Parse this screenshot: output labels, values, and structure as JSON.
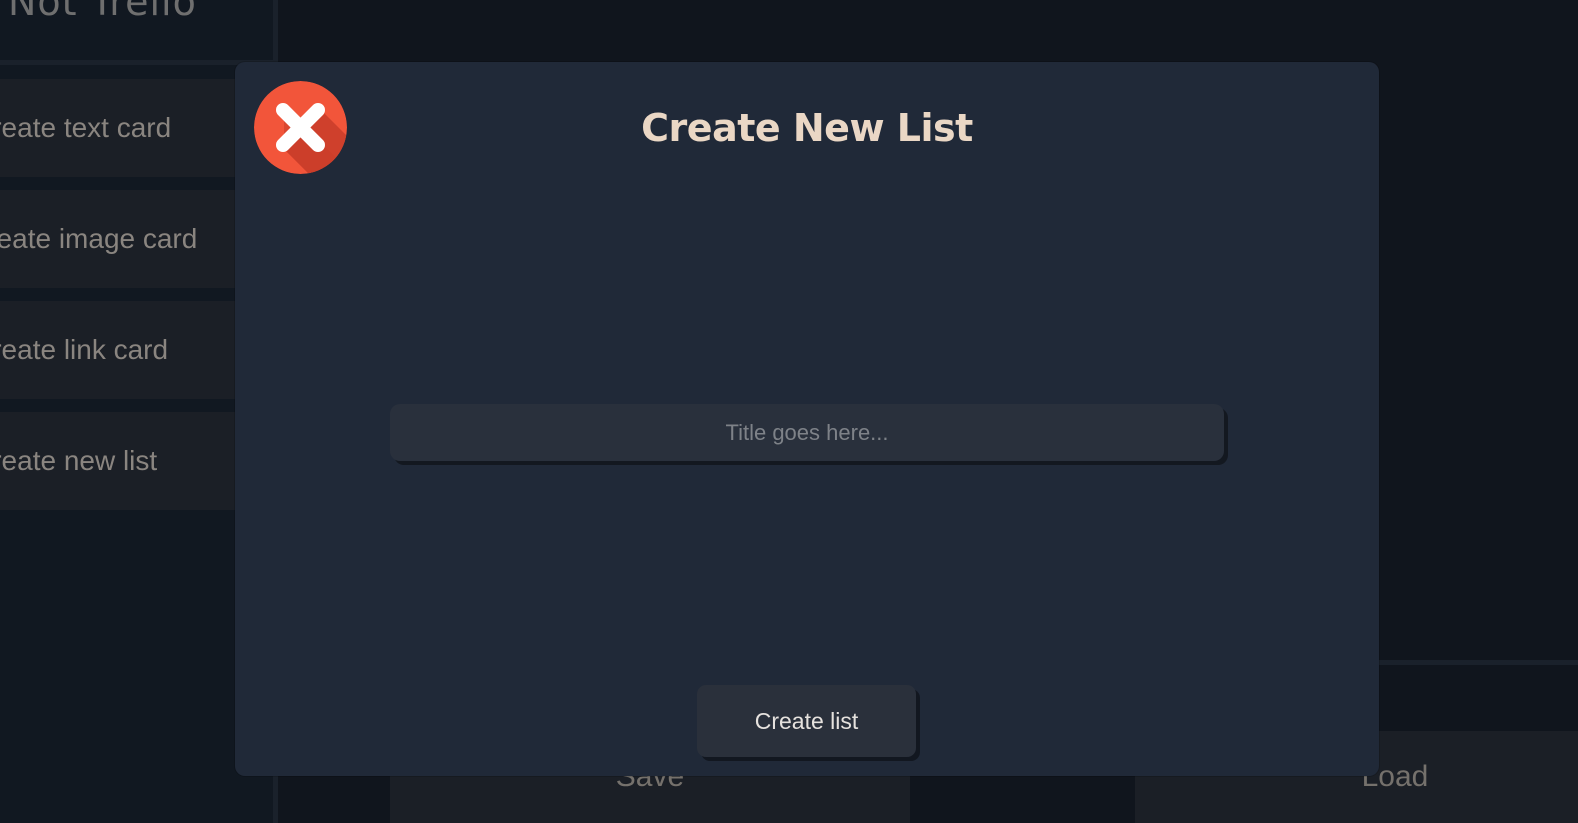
{
  "app": {
    "title": "Not Trello"
  },
  "sidebar": {
    "items": [
      {
        "label": "Create text card"
      },
      {
        "label": "Create image card"
      },
      {
        "label": "Create link card"
      },
      {
        "label": "Create new list"
      }
    ]
  },
  "footer": {
    "save_label": "Save",
    "load_label": "Load"
  },
  "modal": {
    "title": "Create New List",
    "close_icon": "close-x-icon",
    "input": {
      "placeholder": "Title goes here...",
      "value": ""
    },
    "submit_label": "Create list"
  },
  "colors": {
    "page_background": "#10151d",
    "modal_background": "#202938",
    "close_button": "#f2553a",
    "title_text": "#ead7c5"
  }
}
